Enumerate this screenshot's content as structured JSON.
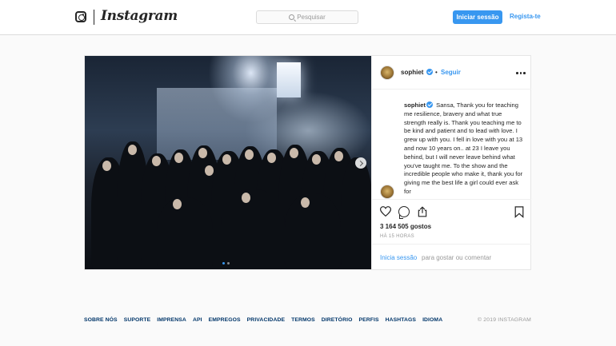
{
  "header": {
    "logo_text": "Instagram",
    "search_placeholder": "Pesquisar",
    "login_label": "Iniciar sessão",
    "signup_label": "Regista-te"
  },
  "post": {
    "username": "sophiet",
    "follow_label": "Seguir",
    "header_separator": "•",
    "caption_username": "sophiet",
    "caption_text": "Sansa, Thank you for teaching me resilience, bravery and what true strength really is. Thank you teaching me to be kind and patient and to lead with love. I grew up with you. I fell in love with you at 13 and now 10 years on.. at 23 I leave you behind, but I will never leave behind what you've taught me. To the show and the incredible people who make it, thank you for giving me the best life a girl could ever ask for",
    "likes": "3 164 505 gostos",
    "time": "HÁ 15 HORAS",
    "login_link": "Inicia sessão",
    "login_prompt": "para gostar ou comentar",
    "carousel": {
      "slides": 2,
      "active": 1
    }
  },
  "footer": {
    "links": [
      "SOBRE NÓS",
      "SUPORTE",
      "IMPRENSA",
      "API",
      "EMPREGOS",
      "PRIVACIDADE",
      "TERMOS",
      "DIRETÓRIO",
      "PERFIS",
      "HASHTAGS",
      "IDIOMA"
    ],
    "copyright": "© 2019 INSTAGRAM"
  },
  "colors": {
    "accent": "#3897f0",
    "footer_link": "#003569",
    "border": "#dbdbdb",
    "background": "#fafafa"
  },
  "icons": [
    "instagram-glyph-icon",
    "search-icon",
    "verified-icon",
    "more-icon",
    "heart-icon",
    "comment-icon",
    "share-icon",
    "bookmark-icon",
    "chevron-right-icon"
  ]
}
